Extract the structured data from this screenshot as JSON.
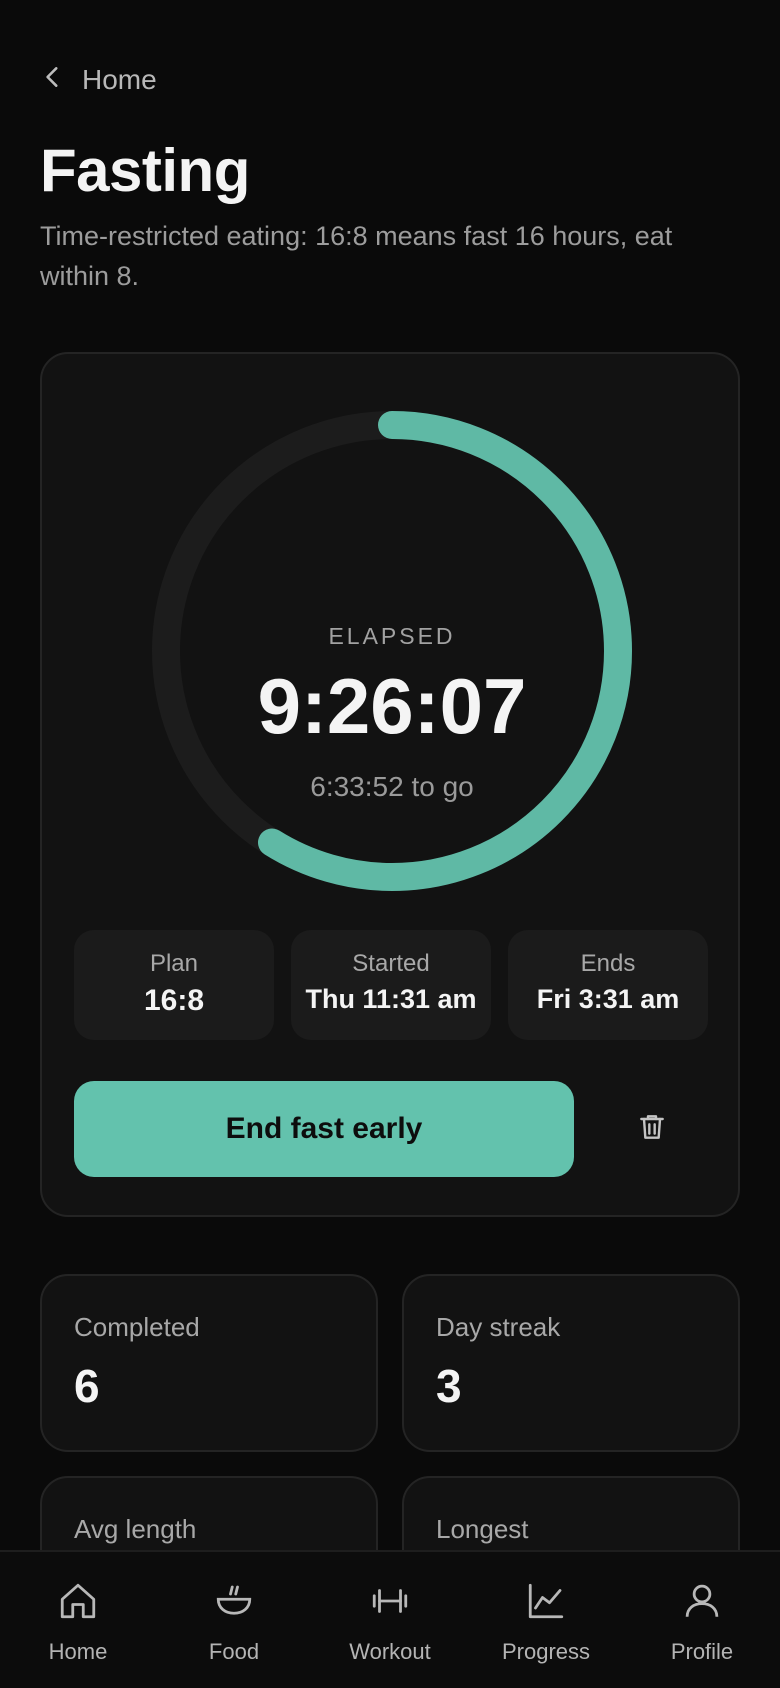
{
  "header": {
    "back_label": "Home",
    "title": "Fasting",
    "subtitle": "Time-restricted eating: 16:8 means fast 16 hours, eat within 8."
  },
  "timer": {
    "elapsed_label": "ELAPSED",
    "elapsed_time": "9:26:07",
    "remaining": "6:33:52 to go",
    "progress_fraction": 0.589,
    "ring_color": "#5fb9a5",
    "track_color": "#1c1c1c"
  },
  "info": {
    "plan_label": "Plan",
    "plan_value": "16:8",
    "started_label": "Started",
    "started_value": "Thu 11:31 am",
    "ends_label": "Ends",
    "ends_value": "Fri 3:31 am"
  },
  "actions": {
    "end_label": "End fast early",
    "accent_color": "#63c2ad"
  },
  "stats": [
    {
      "label": "Completed",
      "value": "6"
    },
    {
      "label": "Day streak",
      "value": "3"
    },
    {
      "label": "Avg length",
      "value": ""
    },
    {
      "label": "Longest",
      "value": ""
    }
  ],
  "nav": [
    {
      "label": "Home",
      "icon": "home-icon"
    },
    {
      "label": "Food",
      "icon": "bowl-icon"
    },
    {
      "label": "Workout",
      "icon": "dumbbell-icon"
    },
    {
      "label": "Progress",
      "icon": "chart-icon"
    },
    {
      "label": "Profile",
      "icon": "user-icon"
    }
  ]
}
